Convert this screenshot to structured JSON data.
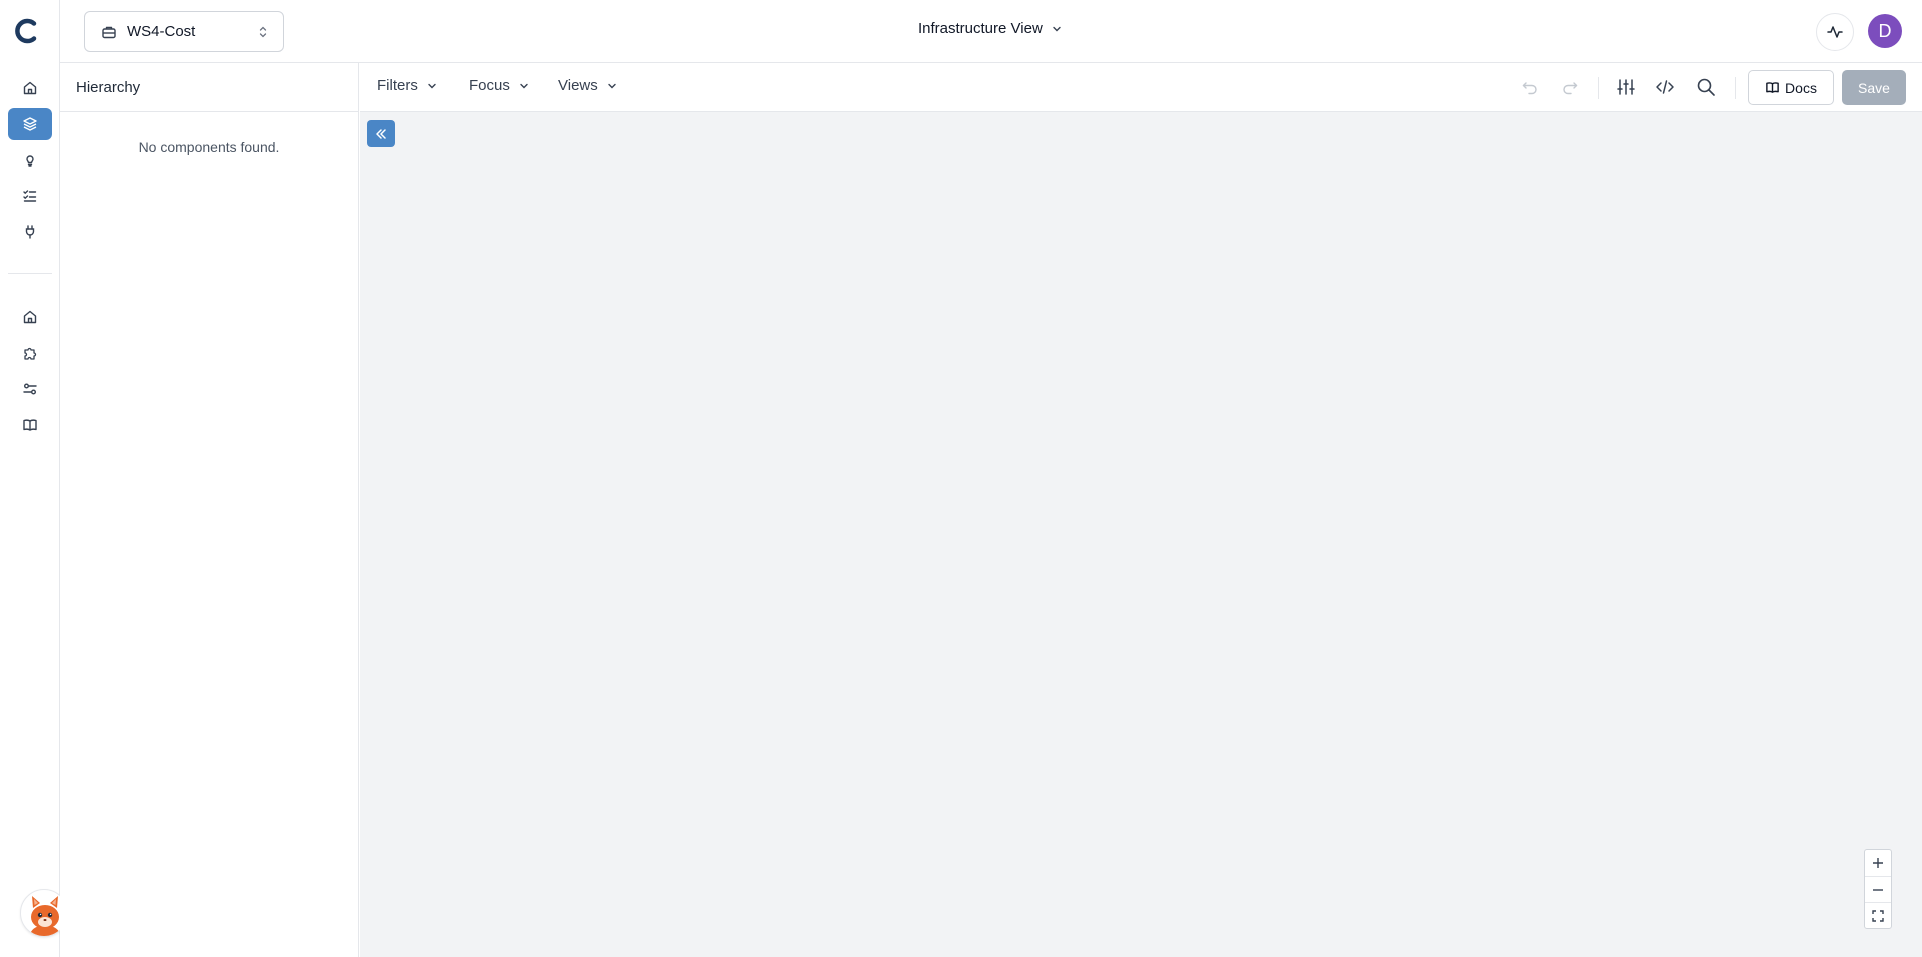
{
  "workspace": {
    "selected": "WS4-Cost"
  },
  "view_title": "Infrastructure View",
  "user": {
    "avatar_initial": "D",
    "avatar_color": "#7c4dbd"
  },
  "hierarchy": {
    "title": "Hierarchy",
    "empty_message": "No components found."
  },
  "toolbar": {
    "menus": [
      "Filters",
      "Focus",
      "Views"
    ],
    "docs_label": "Docs",
    "save_label": "Save"
  },
  "sidebar": {
    "items": [
      {
        "icon": "home-icon",
        "active": false
      },
      {
        "icon": "layers-icon",
        "active": true
      },
      {
        "icon": "lightbulb-icon",
        "active": false
      },
      {
        "icon": "checklist-icon",
        "active": false
      },
      {
        "icon": "plug-icon",
        "active": false
      },
      {
        "icon": "home-icon",
        "active": false
      },
      {
        "icon": "puzzle-icon",
        "active": false
      },
      {
        "icon": "settings-sliders-icon",
        "active": false
      },
      {
        "icon": "book-icon",
        "active": false
      }
    ]
  },
  "colors": {
    "accent": "#4a86c6",
    "canvas": "#f2f3f5",
    "save_disabled": "#a4aeba"
  }
}
